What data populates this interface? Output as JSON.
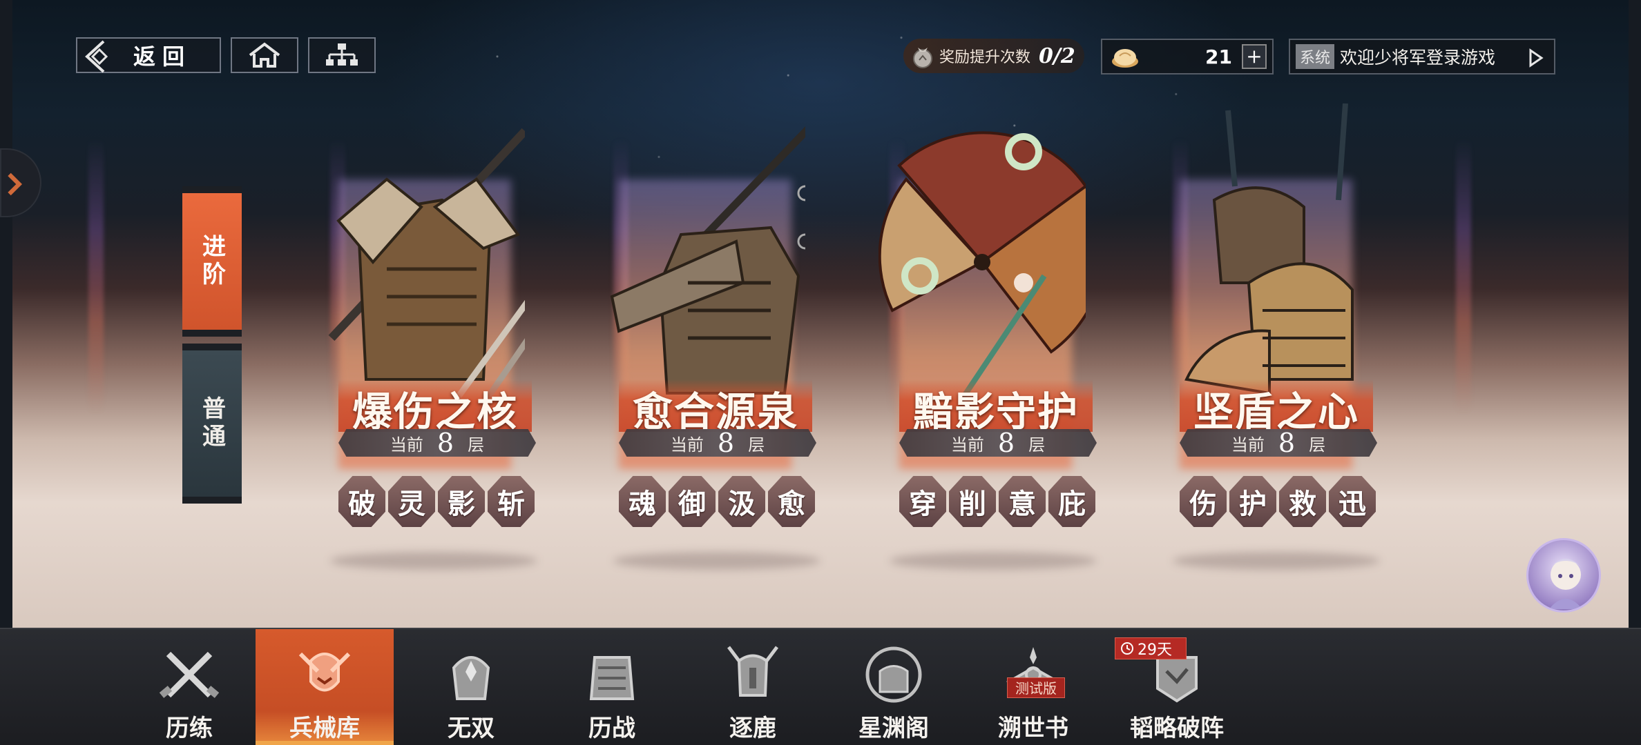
{
  "topbar": {
    "back_label": "返回",
    "reward_label": "奖励提升次数",
    "reward_value": "0/2",
    "currency_value": "21",
    "plus_symbol": "+",
    "system_tag": "系统",
    "system_text": "欢迎少将军登录游戏"
  },
  "mode_tabs": {
    "advanced": "进阶",
    "normal": "普通"
  },
  "cards": [
    {
      "name": "爆伤之核",
      "level_prefix": "当前",
      "level": "8",
      "level_suffix": "层",
      "affixes": [
        "破",
        "灵",
        "影",
        "斩"
      ]
    },
    {
      "name": "愈合源泉",
      "level_prefix": "当前",
      "level": "8",
      "level_suffix": "层",
      "affixes": [
        "魂",
        "御",
        "汲",
        "愈"
      ]
    },
    {
      "name": "黯影守护",
      "level_prefix": "当前",
      "level": "8",
      "level_suffix": "层",
      "affixes": [
        "穿",
        "削",
        "意",
        "庇"
      ]
    },
    {
      "name": "坚盾之心",
      "level_prefix": "当前",
      "level": "8",
      "level_suffix": "层",
      "affixes": [
        "伤",
        "护",
        "救",
        "迅"
      ]
    }
  ],
  "nav": [
    {
      "label": "历练",
      "icon": "crossed-swords-icon",
      "active": false
    },
    {
      "label": "兵械库",
      "icon": "armory-icon",
      "active": true
    },
    {
      "label": "无双",
      "icon": "helmet-icon",
      "active": false
    },
    {
      "label": "历战",
      "icon": "armor-icon",
      "active": false
    },
    {
      "label": "逐鹿",
      "icon": "deer-helmet-icon",
      "active": false
    },
    {
      "label": "星渊阁",
      "icon": "pavilion-icon",
      "active": false
    },
    {
      "label": "溯世书",
      "icon": "book-icon",
      "active": false
    },
    {
      "label": "韬略破阵",
      "icon": "strategy-icon",
      "active": false
    }
  ],
  "badges": {
    "time_left": "29天",
    "test_version": "测试版"
  },
  "colors": {
    "accent": "#d65a2c",
    "tab_normal": "#2f3c43",
    "badge_red": "#b52a24"
  }
}
